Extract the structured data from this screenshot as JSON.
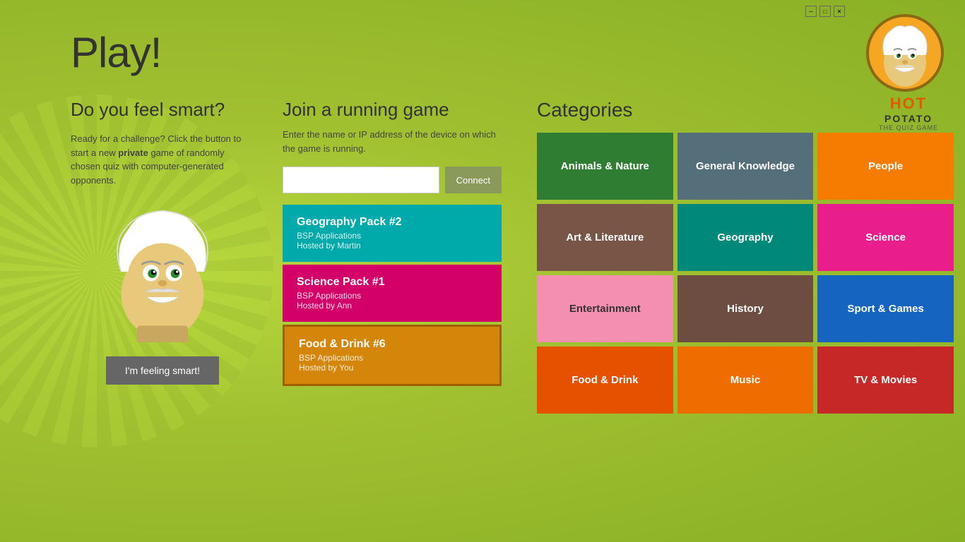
{
  "page": {
    "title": "Play!",
    "background_color": "#a8c93a"
  },
  "logo": {
    "hot": "HOT",
    "potato": "POTATO",
    "quiz_game": "THE QUIZ GAME"
  },
  "left_panel": {
    "heading": "Do you feel smart?",
    "description_plain": "Ready for a challenge? Click the button to start a new ",
    "description_bold": "private",
    "description_end": " game of randomly chosen quiz with computer-generated opponents.",
    "button_label": "I'm feeling smart!"
  },
  "middle_panel": {
    "heading": "Join a running game",
    "description": "Enter the name or IP address of the device on which the game is running.",
    "input_placeholder": "",
    "connect_label": "Connect",
    "games": [
      {
        "name": "Geography Pack #2",
        "developer": "BSP Applications",
        "host": "Hosted by Martin",
        "color_class": "geography"
      },
      {
        "name": "Science Pack #1",
        "developer": "BSP Applications",
        "host": "Hosted by Ann",
        "color_class": "science"
      },
      {
        "name": "Food & Drink #6",
        "developer": "BSP Applications",
        "host": "Hosted by You",
        "color_class": "food"
      }
    ]
  },
  "categories": {
    "heading": "Categories",
    "items": [
      {
        "label": "Animals & Nature",
        "color_class": "cat-animals"
      },
      {
        "label": "General Knowledge",
        "color_class": "cat-general"
      },
      {
        "label": "People",
        "color_class": "cat-people"
      },
      {
        "label": "Art & Literature",
        "color_class": "cat-art"
      },
      {
        "label": "Geography",
        "color_class": "cat-geography"
      },
      {
        "label": "Science",
        "color_class": "cat-science"
      },
      {
        "label": "Entertainment",
        "color_class": "cat-entertainment"
      },
      {
        "label": "History",
        "color_class": "cat-history"
      },
      {
        "label": "Sport & Games",
        "color_class": "cat-sport"
      },
      {
        "label": "Food & Drink",
        "color_class": "cat-food"
      },
      {
        "label": "Music",
        "color_class": "cat-music"
      },
      {
        "label": "TV & Movies",
        "color_class": "cat-tvmovies"
      }
    ]
  }
}
